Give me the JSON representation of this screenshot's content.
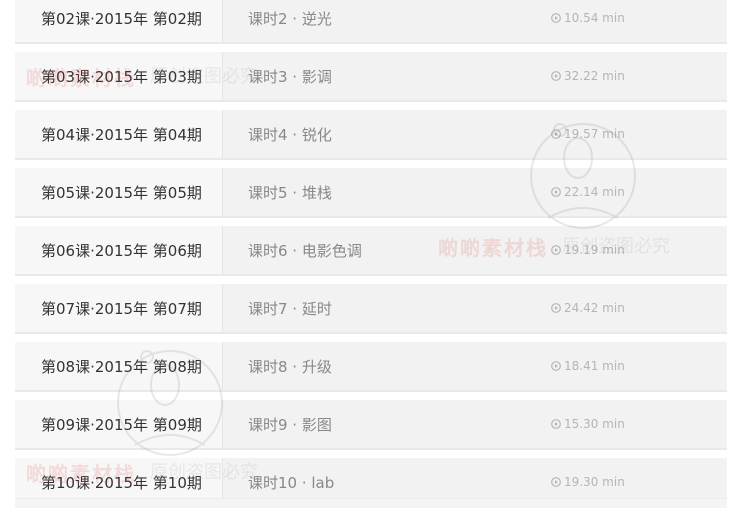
{
  "accent_color": "#e3ece9",
  "rows": [
    {
      "course": "第02课·2015年 第02期",
      "lesson": "课时2 · 逆光",
      "duration": "10.54 min"
    },
    {
      "course": "第03课·2015年 第03期",
      "lesson": "课时3 · 影调",
      "duration": "32.22 min"
    },
    {
      "course": "第04课·2015年 第04期",
      "lesson": "课时4 · 锐化",
      "duration": "19.57 min"
    },
    {
      "course": "第05课·2015年 第05期",
      "lesson": "课时5 · 堆栈",
      "duration": "22.14 min"
    },
    {
      "course": "第06课·2015年 第06期",
      "lesson": "课时6 · 电影色调",
      "duration": "19.19 min"
    },
    {
      "course": "第07课·2015年 第07期",
      "lesson": "课时7 · 延时",
      "duration": "24.42 min"
    },
    {
      "course": "第08课·2015年 第08期",
      "lesson": "课时8 · 升级",
      "duration": "18.41 min"
    },
    {
      "course": "第09课·2015年 第09期",
      "lesson": "课时9 · 影图",
      "duration": "15.30 min"
    },
    {
      "course": "第10课·2015年 第10期",
      "lesson": "课时10 · lab",
      "duration": "19.30 min"
    }
  ],
  "watermark": {
    "brand": "啲啲素材栈",
    "notice": "原创盗图必究",
    "icon": "cartoon-bird-watermark-icon"
  }
}
